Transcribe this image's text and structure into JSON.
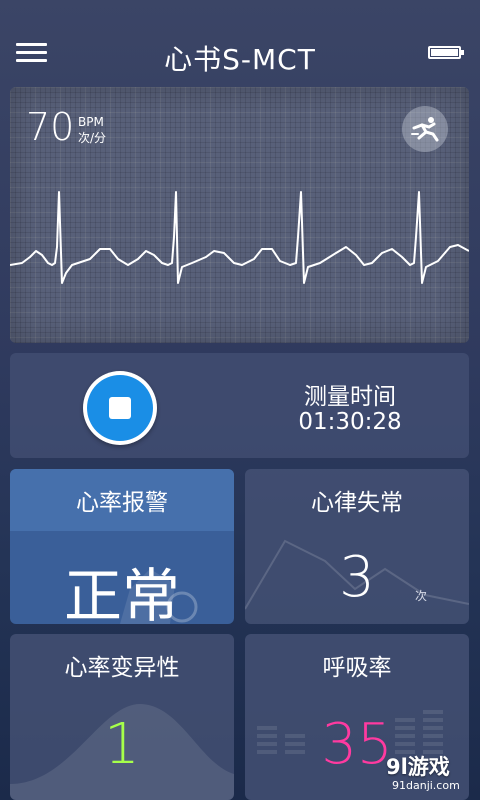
{
  "header": {
    "title": "心书S-MCT",
    "menu_icon": "menu-icon",
    "battery_icon": "battery-icon"
  },
  "ecg": {
    "bpm": "70",
    "unit_en": "BPM",
    "unit_cn": "次/分",
    "activity_icon": "running-person-icon"
  },
  "timer": {
    "label": "测量时间",
    "value": "01:30:28",
    "button_icon": "stop-icon",
    "button_color": "#1a8ee6"
  },
  "tiles": {
    "hr_alarm": {
      "title": "心率报警",
      "value": "正常"
    },
    "arrhythmia": {
      "title": "心律失常",
      "value": "3",
      "unit": "次"
    },
    "hrv": {
      "title": "心率变异性",
      "value": "1",
      "color": "#a6ff4a"
    },
    "resp": {
      "title": "呼吸率",
      "value": "35",
      "color": "#ff3aa0"
    }
  },
  "watermark": {
    "logo": "9l游戏",
    "url": "91danji.com"
  }
}
